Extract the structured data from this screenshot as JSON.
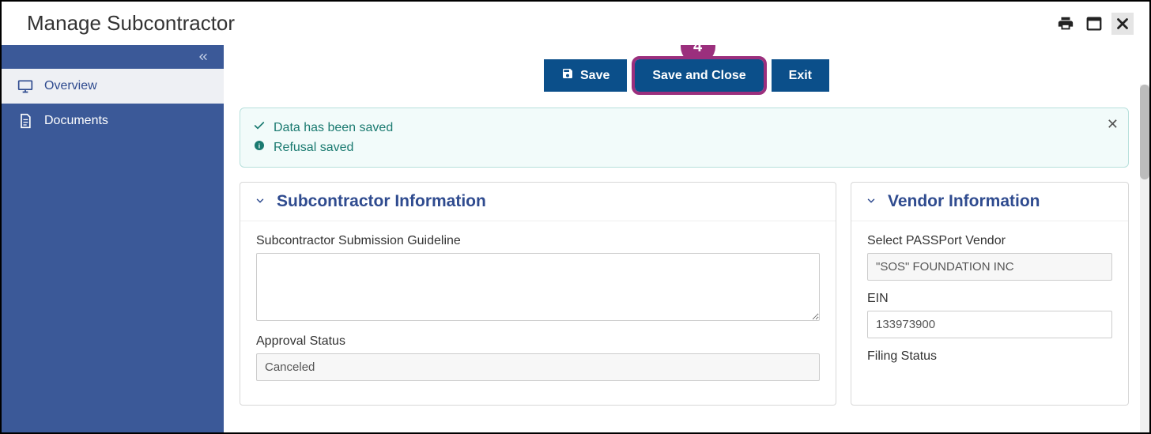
{
  "header": {
    "title": "Manage Subcontractor"
  },
  "step_badge": "4",
  "sidebar": {
    "items": [
      {
        "label": "Overview",
        "active": true
      },
      {
        "label": "Documents",
        "active": false
      }
    ]
  },
  "toolbar": {
    "save_label": "Save",
    "save_close_label": "Save and Close",
    "exit_label": "Exit"
  },
  "alert": {
    "line1": "Data has been saved",
    "line2": "Refusal saved"
  },
  "subcontractor_panel": {
    "title": "Subcontractor Information",
    "guideline_label": "Subcontractor Submission Guideline",
    "guideline_value": "",
    "approval_label": "Approval Status",
    "approval_value": "Canceled"
  },
  "vendor_panel": {
    "title": "Vendor Information",
    "select_label": "Select PASSPort Vendor",
    "select_value": "\"SOS\" FOUNDATION INC",
    "ein_label": "EIN",
    "ein_value": "133973900",
    "filing_label": "Filing Status"
  }
}
